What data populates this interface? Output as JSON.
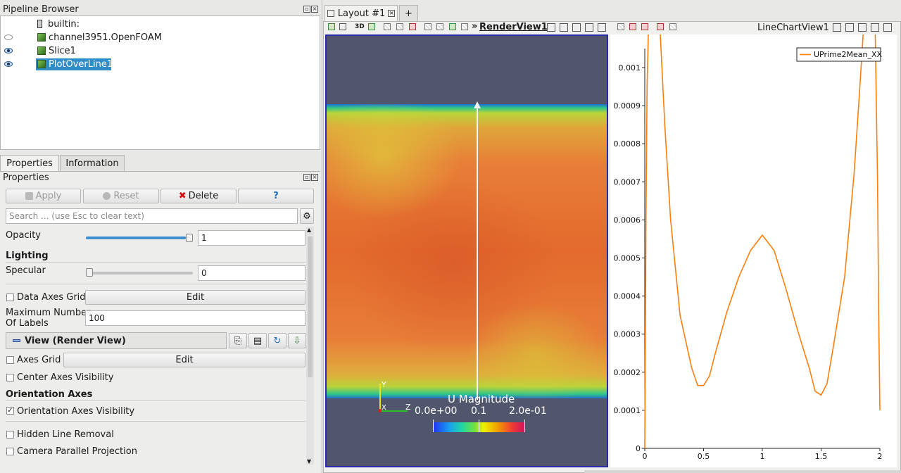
{
  "pipeline": {
    "title": "Pipeline Browser",
    "items": [
      {
        "label": "builtin:",
        "eye": "none"
      },
      {
        "label": "channel3951.OpenFOAM",
        "eye": "hidden"
      },
      {
        "label": "Slice1",
        "eye": "visible"
      },
      {
        "label": "PlotOverLine1",
        "eye": "visible",
        "selected": true
      }
    ]
  },
  "panel_tabs": [
    "Properties",
    "Information"
  ],
  "properties": {
    "title": "Properties",
    "apply_label": "Apply",
    "reset_label": "Reset",
    "delete_label": "Delete",
    "help_label": "?",
    "search_placeholder": "Search ... (use Esc to clear text)",
    "opacity_label": "Opacity",
    "opacity_value": "1",
    "opacity_level": 1.0,
    "lighting_header": "Lighting",
    "specular_label": "Specular",
    "specular_value": "0",
    "specular_level": 0.0,
    "data_axes_grid_label": "Data Axes Grid",
    "edit_label": "Edit",
    "max_labels_label_line1": "Maximum Number",
    "max_labels_label_line2": "Of Labels",
    "max_labels_value": "100",
    "view_section": "View (Render View)",
    "axes_grid_label": "Axes Grid",
    "center_axes_label": "Center Axes Visibility",
    "orientation_header": "Orientation Axes",
    "orientation_vis_label": "Orientation Axes Visibility",
    "orientation_vis_checked": true,
    "hidden_line_label": "Hidden Line Removal",
    "camera_parallel_label": "Camera Parallel Projection"
  },
  "layout": {
    "tab_label": "Layout #1",
    "add_tab": "+",
    "toolbar_3d": "3D",
    "render_view_name": "RenderView1",
    "chart_view_name": "LineChartView1"
  },
  "render_view": {
    "colorbar_title": "U Magnitude",
    "colorbar_min": "0.0e+00",
    "colorbar_mid": "0.1",
    "colorbar_max": "2.0e-01",
    "axis_y": "Y",
    "axis_x": "X",
    "axis_z": "Z",
    "colors": {
      "background": "#52566c",
      "field_core": "#e06a2a",
      "field_edge": "#c9d42c"
    }
  },
  "chart_data": {
    "type": "line",
    "title": "",
    "xlabel": "",
    "ylabel": "",
    "xlim": [
      0,
      2
    ],
    "ylim": [
      0,
      0.00105
    ],
    "x_ticks": [
      "0",
      "0.5",
      "1",
      "1.5",
      "2"
    ],
    "y_ticks": [
      "0",
      "0.0001",
      "0.0002",
      "0.0003",
      "0.0004",
      "0.0005",
      "0.0006",
      "0.0007",
      "0.0008",
      "0.0009",
      "0.001"
    ],
    "legend_position": "top-right",
    "series": [
      {
        "name": "UPrime2Mean_XX",
        "color": "#ff7f0e",
        "x": [
          0,
          0.01,
          0.02,
          0.04,
          0.06,
          0.08,
          0.1,
          0.13,
          0.17,
          0.22,
          0.3,
          0.4,
          0.45,
          0.5,
          0.55,
          0.6,
          0.7,
          0.8,
          0.9,
          1.0,
          1.1,
          1.2,
          1.3,
          1.4,
          1.45,
          1.5,
          1.55,
          1.6,
          1.7,
          1.78,
          1.83,
          1.87,
          1.9,
          1.92,
          1.94,
          1.96,
          1.98,
          1.99,
          2.0
        ],
        "y": [
          0,
          0.0006,
          0.00095,
          0.00122,
          0.00128,
          0.00129,
          0.00126,
          0.0011,
          0.00085,
          0.0006,
          0.00035,
          0.00021,
          0.000165,
          0.000165,
          0.00019,
          0.00025,
          0.00036,
          0.00045,
          0.00052,
          0.00056,
          0.00052,
          0.00042,
          0.00031,
          0.00021,
          0.00015,
          0.00014,
          0.00017,
          0.00026,
          0.00045,
          0.00072,
          0.00095,
          0.00115,
          0.00126,
          0.00129,
          0.00127,
          0.0011,
          0.0007,
          0.00035,
          0.0001
        ]
      }
    ]
  }
}
